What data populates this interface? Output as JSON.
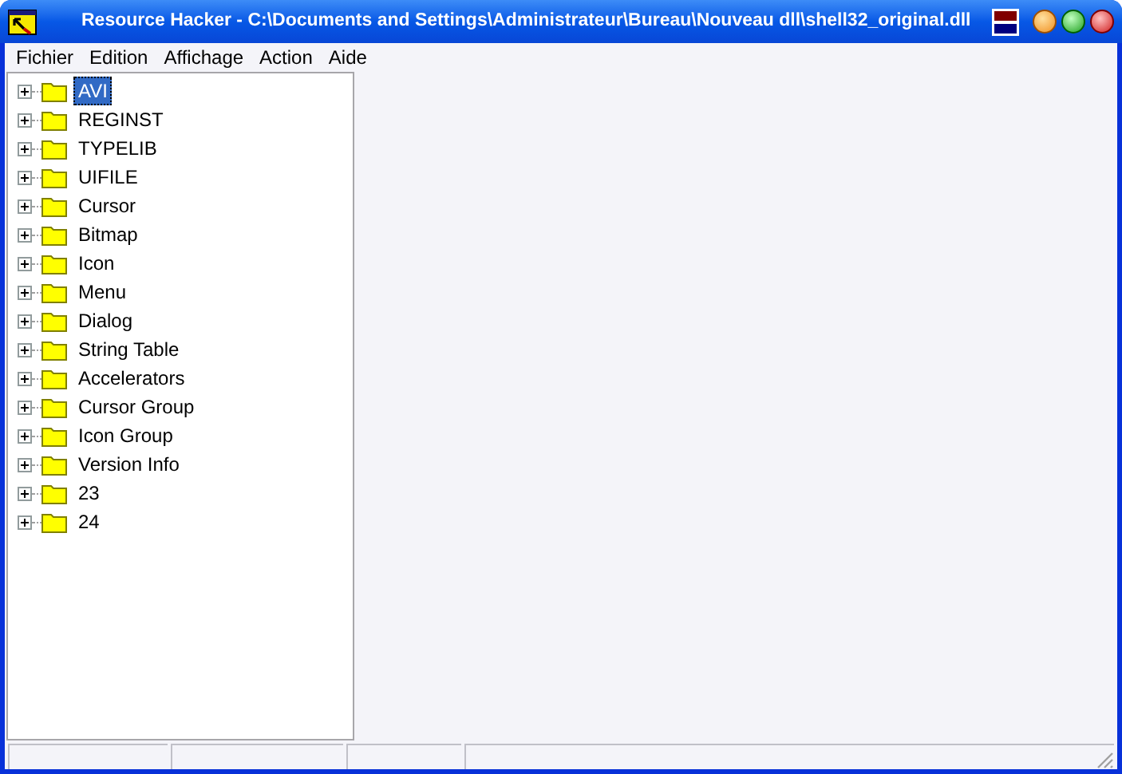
{
  "window": {
    "title": "Resource Hacker  -  C:\\Documents and Settings\\Administrateur\\Bureau\\Nouveau dll\\shell32_original.dll"
  },
  "menu": [
    "Fichier",
    "Edition",
    "Affichage",
    "Action",
    "Aide"
  ],
  "tree": {
    "items": [
      {
        "label": "AVI",
        "selected": true,
        "expanded": false
      },
      {
        "label": "REGINST",
        "selected": false,
        "expanded": false
      },
      {
        "label": "TYPELIB",
        "selected": false,
        "expanded": false
      },
      {
        "label": "UIFILE",
        "selected": false,
        "expanded": false
      },
      {
        "label": "Cursor",
        "selected": false,
        "expanded": false
      },
      {
        "label": "Bitmap",
        "selected": false,
        "expanded": false
      },
      {
        "label": "Icon",
        "selected": false,
        "expanded": false
      },
      {
        "label": "Menu",
        "selected": false,
        "expanded": false
      },
      {
        "label": "Dialog",
        "selected": false,
        "expanded": false
      },
      {
        "label": "String Table",
        "selected": false,
        "expanded": false
      },
      {
        "label": "Accelerators",
        "selected": false,
        "expanded": false
      },
      {
        "label": "Cursor Group",
        "selected": false,
        "expanded": false
      },
      {
        "label": "Icon Group",
        "selected": false,
        "expanded": false
      },
      {
        "label": "Version Info",
        "selected": false,
        "expanded": false
      },
      {
        "label": "23",
        "selected": false,
        "expanded": false
      },
      {
        "label": "24",
        "selected": false,
        "expanded": false
      }
    ]
  }
}
